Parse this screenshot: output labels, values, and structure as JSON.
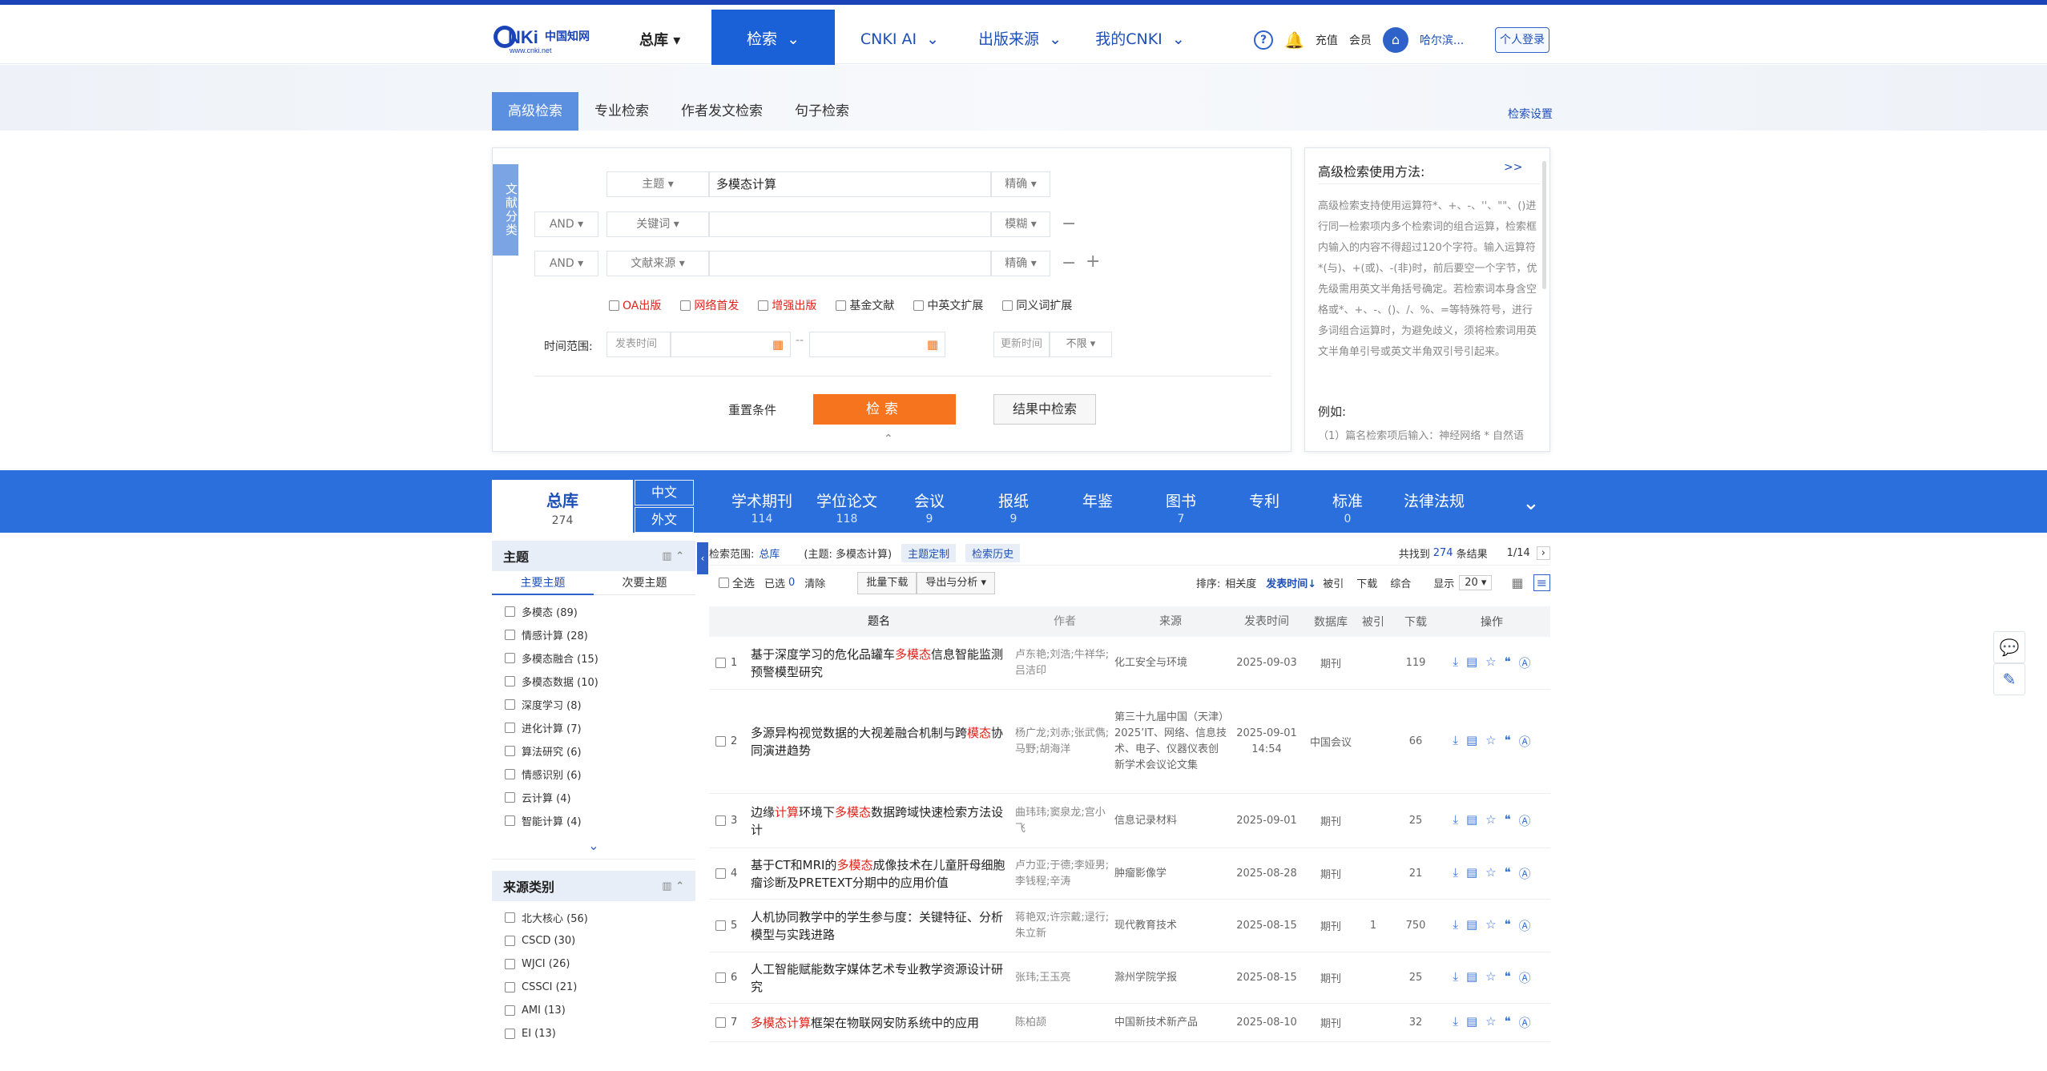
{
  "header": {
    "logo_text": "CNKi中国知网",
    "logo_sub": "www.cnki.net",
    "db_select": "总库",
    "nav": [
      {
        "label": "检索"
      },
      {
        "label": "CNKI AI"
      },
      {
        "label": "出版来源"
      },
      {
        "label": "我的CNKI"
      }
    ],
    "recharge": "充值",
    "member": "会员",
    "username": "哈尔滨...",
    "login": "个人登录"
  },
  "tabs": [
    "高级检索",
    "专业检索",
    "作者发文检索",
    "句子检索"
  ],
  "search_settings": "检索设置",
  "form": {
    "side_tab": "文献分类",
    "rows": [
      {
        "op": "",
        "field": "主题",
        "value": "多模态计算",
        "match": "精确"
      },
      {
        "op": "AND",
        "field": "关键词",
        "value": "",
        "match": "模糊"
      },
      {
        "op": "AND",
        "field": "文献来源",
        "value": "",
        "match": "精确"
      }
    ],
    "checks": [
      {
        "label": "OA出版",
        "red": true
      },
      {
        "label": "网络首发",
        "red": true
      },
      {
        "label": "增强出版",
        "red": true
      },
      {
        "label": "基金文献",
        "red": false
      },
      {
        "label": "中英文扩展",
        "red": false
      },
      {
        "label": "同义词扩展",
        "red": false
      }
    ],
    "time_label": "时间范围:",
    "pub_time": "发表时间",
    "update_time": "更新时间",
    "update_value": "不限",
    "reset": "重置条件",
    "search": "检索",
    "in_results": "结果中检索"
  },
  "help": {
    "title": "高级检索使用方法:",
    "more": ">>",
    "body": "高级检索支持使用运算符*、+、-、''、\"\"、()进行同一检索项内多个检索词的组合运算，检索框内输入的内容不得超过120个字符。输入运算符*(与)、+(或)、-(非)时，前后要空一个字节，优先级需用英文半角括号确定。若检索词本身含空格或*、+、-、()、/、%、=等特殊符号，进行多词组合运算时，为避免歧义，须将检索词用英文半角单引号或英文半角双引号引起来。",
    "example": "例如:",
    "example_line": "（1）篇名检索项后输入：神经网络 * 自然语"
  },
  "dbbar": {
    "zongku": "总库",
    "zongku_count": "274",
    "zhongwen": "中文",
    "waiwen": "外文",
    "items": [
      {
        "label": "学术期刊",
        "count": "114"
      },
      {
        "label": "学位论文",
        "count": "118"
      },
      {
        "label": "会议",
        "count": "9"
      },
      {
        "label": "报纸",
        "count": "9"
      },
      {
        "label": "年鉴",
        "count": ""
      },
      {
        "label": "图书",
        "count": "7"
      },
      {
        "label": "专利",
        "count": ""
      },
      {
        "label": "标准",
        "count": "0"
      },
      {
        "label": "法律法规",
        "count": ""
      }
    ]
  },
  "facets": {
    "topic": {
      "title": "主题",
      "tab_main": "主要主题",
      "tab_sub": "次要主题",
      "items": [
        "多模态 (89)",
        "情感计算 (28)",
        "多模态融合 (15)",
        "多模态数据 (10)",
        "深度学习 (8)",
        "进化计算 (7)",
        "算法研究 (6)",
        "情感识别 (6)",
        "云计算 (4)",
        "智能计算 (4)"
      ]
    },
    "source": {
      "title": "来源类别",
      "items": [
        "北大核心 (56)",
        "CSCD (30)",
        "WJCI (26)",
        "CSSCI (21)",
        "AMI (13)",
        "EI (13)"
      ]
    }
  },
  "results": {
    "scope_label": "检索范围:",
    "scope_value": "总库",
    "query": "(主题: 多模态计算)",
    "topic_custom": "主题定制",
    "history": "检索历史",
    "found_prefix": "共找到",
    "found_count": "274",
    "found_suffix": "条结果",
    "page": "1/14",
    "select_all": "全选",
    "selected_label": "已选",
    "selected_count": "0",
    "clear": "清除",
    "batch_download": "批量下载",
    "export": "导出与分析",
    "sort_label": "排序:",
    "sort_items": [
      "相关度",
      "发表时间",
      "被引",
      "下载",
      "综合"
    ],
    "show_label": "显示",
    "show_value": "20",
    "columns": [
      "题名",
      "作者",
      "来源",
      "发表时间",
      "数据库",
      "被引",
      "下载",
      "操作"
    ],
    "rows": [
      {
        "n": "1",
        "title": "基于深度学习的危化品罐车多模态信息智能监测预警模型研究",
        "author": "卢东艳;刘浩;牛祥华;吕洁印",
        "source": "化工安全与环境",
        "date": "2025-09-03",
        "db": "期刊",
        "cite": "",
        "dl": "119"
      },
      {
        "n": "2",
        "title": "多源异构视觉数据的大视差融合机制与跨模态协同演进趋势",
        "author": "杨广龙;刘赤;张武儁;马野;胡海洋",
        "source": "第三十九届中国（天津）2025’IT、网络、信息技术、电子、仪器仪表创新学术会议论文集",
        "date": "2025-09-01 14:54",
        "db": "中国会议",
        "cite": "",
        "dl": "66"
      },
      {
        "n": "3",
        "title": "边缘计算环境下多模态数据跨域快速检索方法设计",
        "author": "曲玮玮;窦泉龙;宫小飞",
        "source": "信息记录材料",
        "date": "2025-09-01",
        "db": "期刊",
        "cite": "",
        "dl": "25"
      },
      {
        "n": "4",
        "title": "基于CT和MRI的多模态成像技术在儿童肝母细胞瘤诊断及PRETEXT分期中的应用价值",
        "author": "卢力亚;于德;李娅男;李钱程;辛涛",
        "source": "肿瘤影像学",
        "date": "2025-08-28",
        "db": "期刊",
        "cite": "",
        "dl": "21"
      },
      {
        "n": "5",
        "title": "人机协同教学中的学生参与度：关键特征、分析模型与实践进路",
        "author": "蒋艳双;许宗戴;逯行;朱立新",
        "source": "现代教育技术",
        "date": "2025-08-15",
        "db": "期刊",
        "cite": "1",
        "dl": "750"
      },
      {
        "n": "6",
        "title": "人工智能赋能数字媒体艺术专业教学资源设计研究",
        "author": "张玮;王玉亮",
        "source": "滁州学院学报",
        "date": "2025-08-15",
        "db": "期刊",
        "cite": "",
        "dl": "25"
      },
      {
        "n": "7",
        "title": "多模态计算框架在物联网安防系统中的应用",
        "author": "陈柏颉",
        "source": "中国新技术新产品",
        "date": "2025-08-10",
        "db": "期刊",
        "cite": "",
        "dl": "32"
      }
    ]
  }
}
